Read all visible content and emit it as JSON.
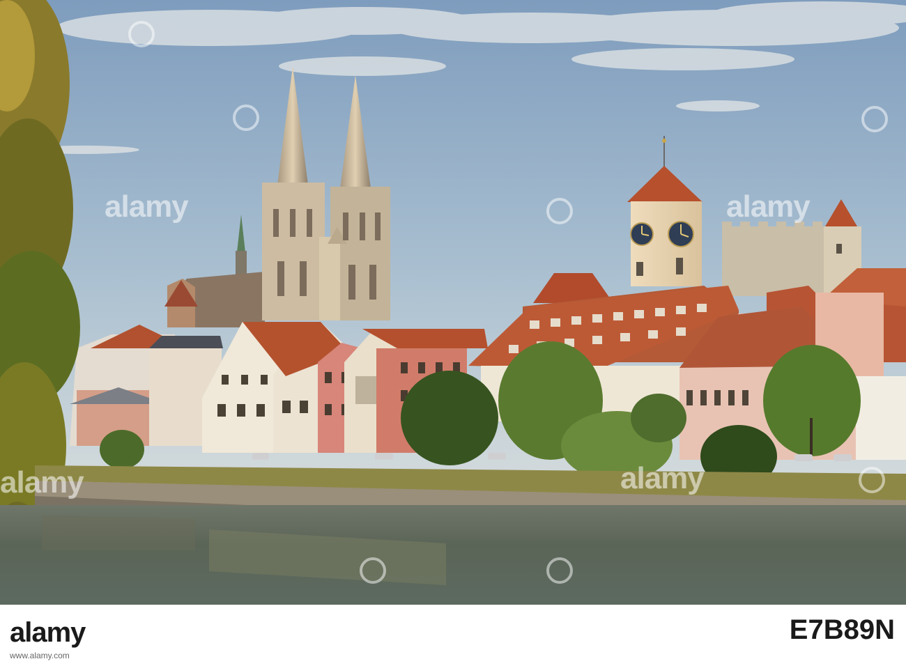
{
  "watermark": {
    "text": "alamy"
  },
  "footer": {
    "brand": "alamy",
    "image_code": "E7B89N",
    "brand_url": "www.alamy.com"
  },
  "clock_faces": {
    "icon": "clock-icon"
  },
  "colors": {
    "sky_top": "#6d8fb3",
    "sky_bottom": "#c9d6df",
    "river": "#5d6658",
    "roof": "#b8542f",
    "foliage": "#3f5a22"
  }
}
